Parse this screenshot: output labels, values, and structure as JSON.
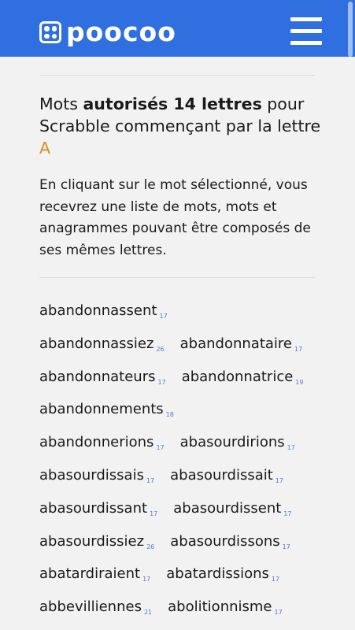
{
  "header": {
    "logo_text": "poocoo",
    "brand_color": "#2f6fe0"
  },
  "title": {
    "part1": "Mots ",
    "bold": "autorisés 14 lettres",
    "part2": " pour Scrabble commençant par la lettre ",
    "letter": "A",
    "letter_color": "#e08a1e"
  },
  "intro": "En cliquant sur le mot sélectionné, vous recevrez une liste de mots, mots et anagrammes pouvant être composés de ses mêmes lettres.",
  "words": [
    {
      "word": "abandonnassent",
      "score": "17"
    },
    {
      "word": "abandonnassiez",
      "score": "26"
    },
    {
      "word": "abandonnataire",
      "score": "17"
    },
    {
      "word": "abandonnateurs",
      "score": "17"
    },
    {
      "word": "abandonnatrice",
      "score": "19"
    },
    {
      "word": "abandonnements",
      "score": "18"
    },
    {
      "word": "abandonnerions",
      "score": "17"
    },
    {
      "word": "abasourdirions",
      "score": "17"
    },
    {
      "word": "abasourdissais",
      "score": "17"
    },
    {
      "word": "abasourdissait",
      "score": "17"
    },
    {
      "word": "abasourdissant",
      "score": "17"
    },
    {
      "word": "abasourdissent",
      "score": "17"
    },
    {
      "word": "abasourdissiez",
      "score": "26"
    },
    {
      "word": "abasourdissons",
      "score": "17"
    },
    {
      "word": "abatardiraient",
      "score": "17"
    },
    {
      "word": "abatardissions",
      "score": "17"
    },
    {
      "word": "abbevilliennes",
      "score": "21"
    },
    {
      "word": "abolitionnisme",
      "score": "17"
    }
  ]
}
